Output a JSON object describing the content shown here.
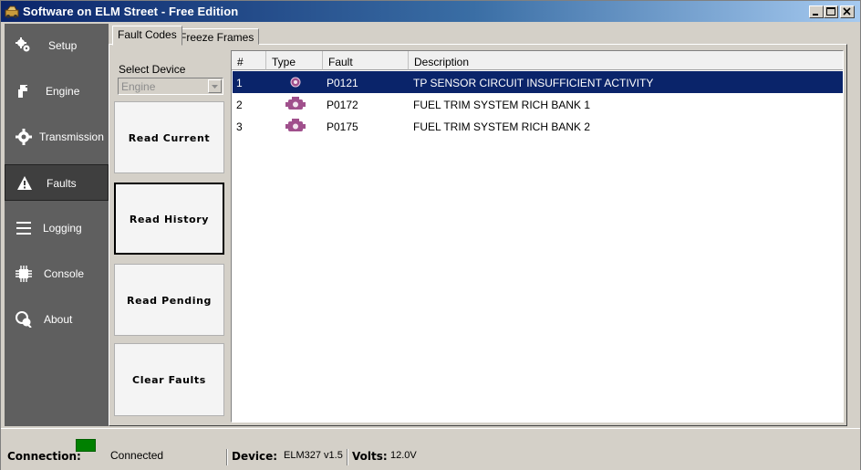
{
  "window": {
    "title": "Software on ELM Street - Free Edition"
  },
  "sidebar": {
    "items": [
      {
        "label": "Setup",
        "icon": "gears-icon"
      },
      {
        "label": "Engine",
        "icon": "engine-icon"
      },
      {
        "label": "Transmission",
        "icon": "gear-icon"
      },
      {
        "label": "Faults",
        "icon": "warning-icon",
        "active": true
      },
      {
        "label": "Logging",
        "icon": "menu-lines-icon"
      },
      {
        "label": "Console",
        "icon": "chip-icon"
      },
      {
        "label": "About",
        "icon": "chat-bubbles-icon"
      }
    ]
  },
  "tabs": [
    {
      "label": "Fault Codes",
      "active": true
    },
    {
      "label": "Freeze Frames",
      "active": false
    }
  ],
  "device_select": {
    "label": "Select Device",
    "value": "Engine"
  },
  "actions": {
    "read_current": "Read Current",
    "read_history": "Read History",
    "read_pending": "Read Pending",
    "clear_faults": "Clear Faults"
  },
  "table": {
    "columns": [
      "#",
      "Type",
      "Fault",
      "Description"
    ],
    "rows": [
      {
        "num": "1",
        "fault": "P0121",
        "description": "TP SENSOR CIRCUIT INSUFFICIENT ACTIVITY",
        "selected": true
      },
      {
        "num": "2",
        "fault": "P0172",
        "description": "FUEL TRIM SYSTEM RICH BANK 1"
      },
      {
        "num": "3",
        "fault": "P0175",
        "description": "FUEL TRIM SYSTEM RICH BANK 2"
      }
    ]
  },
  "status": {
    "connection_label": "Connection:",
    "connection_value": "Connected",
    "device_label": "Device:",
    "device_value": "ELM327 v1.5",
    "volts_label": "Volts:",
    "volts_value": "12.0V"
  },
  "colors": {
    "selection": "#0a246a",
    "sidebar": "#5f5f5f",
    "connected_led": "#008000",
    "fault_icon": "#a0508c"
  }
}
